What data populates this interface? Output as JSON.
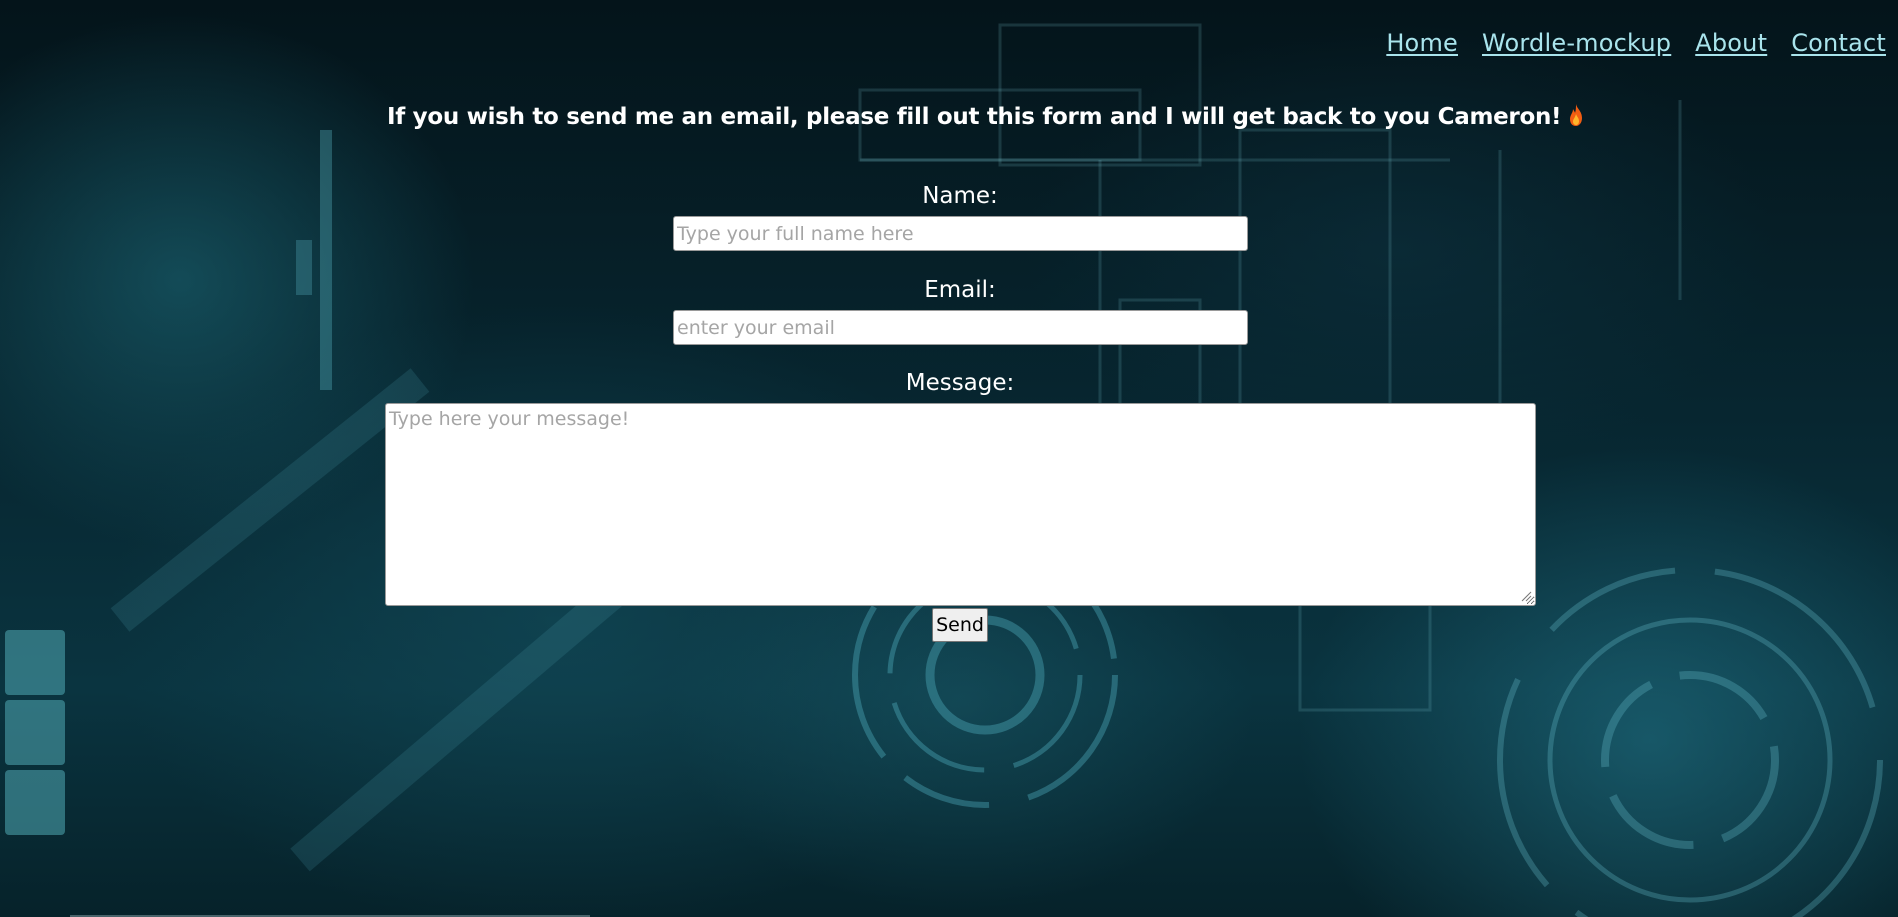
{
  "nav": {
    "items": [
      {
        "label": "Home"
      },
      {
        "label": "Wordle-mockup"
      },
      {
        "label": "About"
      },
      {
        "label": "Contact"
      }
    ],
    "link_color": "#a9e4ec"
  },
  "heading": {
    "text": "If you wish to send me an email, please fill out this form and I will get back to you Cameron!",
    "icon": "fire-emoji-icon"
  },
  "form": {
    "name": {
      "label": "Name:",
      "placeholder": "Type your full name here",
      "value": ""
    },
    "email": {
      "label": "Email:",
      "placeholder": "enter your email",
      "value": ""
    },
    "message": {
      "label": "Message:",
      "placeholder": "Type here your message!",
      "value": ""
    },
    "submit_label": "Send"
  },
  "theme": {
    "background": "#072630",
    "text": "#ffffff",
    "accent": "#a9e4ec"
  }
}
